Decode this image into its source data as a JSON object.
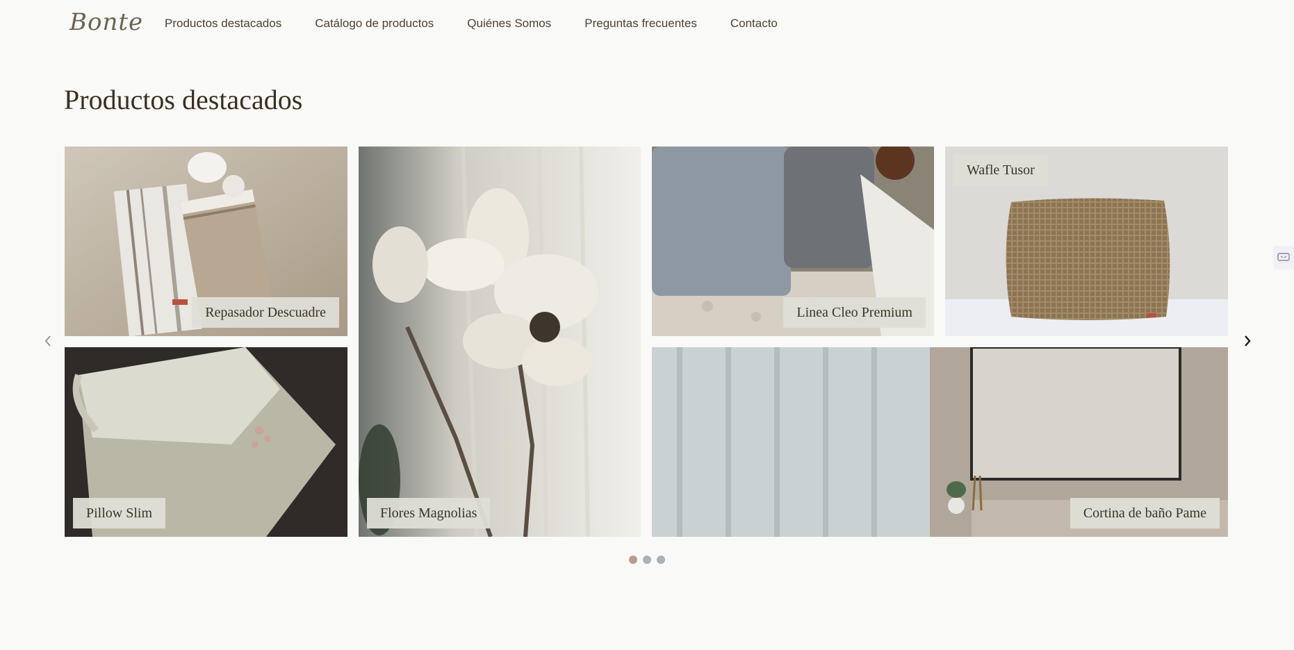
{
  "brand": {
    "logo_text": "Bonte"
  },
  "nav": {
    "items": [
      {
        "label": "Productos destacados"
      },
      {
        "label": "Catálogo de productos"
      },
      {
        "label": "Quiénes Somos"
      },
      {
        "label": "Preguntas frecuentes"
      },
      {
        "label": "Contacto"
      }
    ]
  },
  "section": {
    "title": "Productos destacados"
  },
  "gallery": {
    "items": [
      {
        "label": "Repasador Descuadre",
        "image": "kitchen-towels-photo"
      },
      {
        "label": "Flores Magnolias",
        "image": "magnolia-flower-photo"
      },
      {
        "label": "Linea Cleo Premium",
        "image": "grey-cushions-photo"
      },
      {
        "label": "Wafle Tusor",
        "image": "waffle-cushion-photo"
      },
      {
        "label": "Pillow Slim",
        "image": "folded-quilt-photo"
      },
      {
        "label": "Cortina de baño Pame",
        "image": "shower-curtain-photo"
      }
    ],
    "pagination": {
      "pages": 3,
      "current": 1
    },
    "prev_icon": "chevron-left-icon",
    "next_icon": "chevron-right-icon"
  },
  "colors": {
    "background": "#f9f9f8",
    "label_bg": "#dedfd6",
    "dot_active": "#b89b8e",
    "dot_inactive": "#a9b1bb"
  }
}
